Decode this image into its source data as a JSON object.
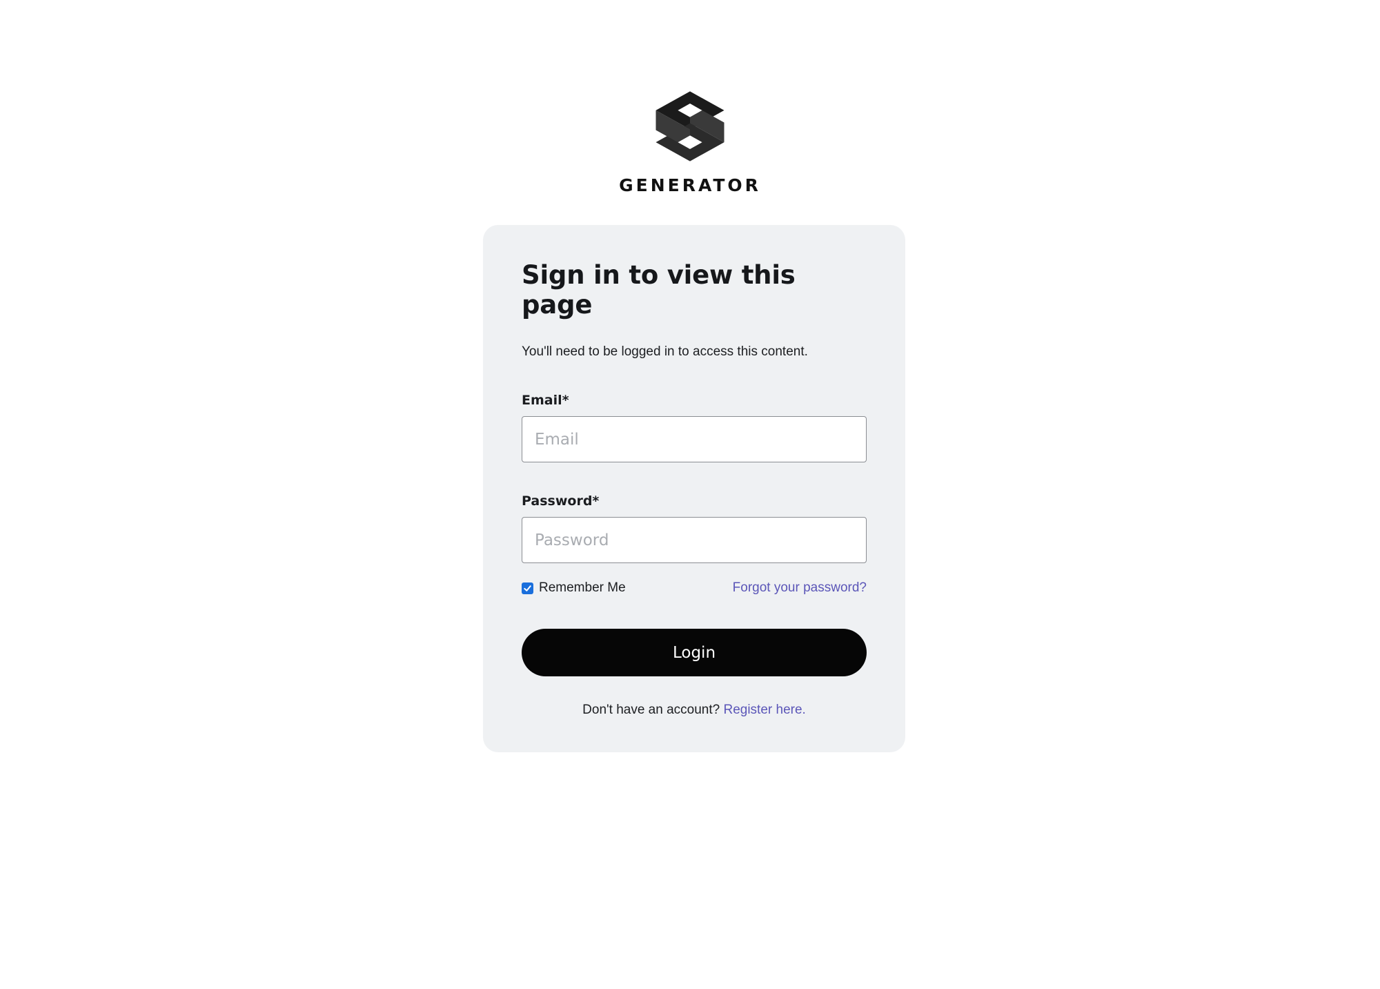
{
  "brand": {
    "name": "GENERATOR",
    "mark_icon": "generator-logo-icon",
    "color": "#111111"
  },
  "card": {
    "title": "Sign in to view this page",
    "subtitle": "You'll need to be logged in to access this content.",
    "background": "#eff1f3"
  },
  "form": {
    "email": {
      "label": "Email*",
      "placeholder": "Email",
      "value": ""
    },
    "password": {
      "label": "Password*",
      "placeholder": "Password",
      "value": ""
    },
    "remember_me": {
      "label": "Remember Me",
      "checked": true,
      "icon": "checkmark-icon"
    },
    "forgot_password": "Forgot your password?",
    "login_button": "Login"
  },
  "register": {
    "prompt": "Don't have an account?",
    "link_text": "Register here."
  },
  "colors": {
    "accent_link": "#5b56b8",
    "button_bg": "#060606",
    "checkbox": "#1a6fdc"
  }
}
